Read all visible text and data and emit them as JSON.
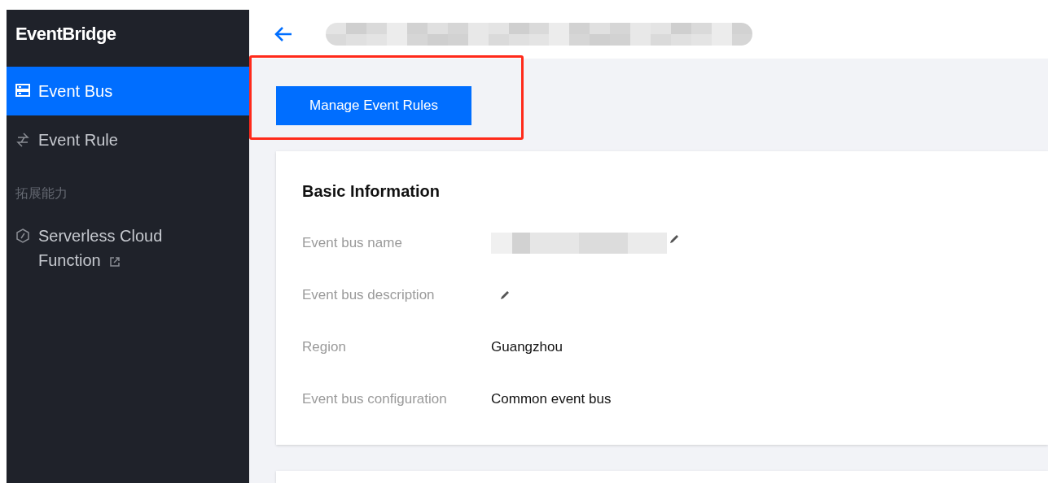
{
  "sidebar": {
    "title": "EventBridge",
    "items": [
      {
        "kind": "item",
        "label": "Event Bus",
        "selected": true,
        "external": false
      },
      {
        "kind": "item",
        "label": "Event Rule",
        "selected": false,
        "external": false
      },
      {
        "kind": "group",
        "label": "拓展能力"
      },
      {
        "kind": "item",
        "label": "Serverless Cloud Function",
        "selected": false,
        "external": true
      }
    ]
  },
  "toolbar": {
    "button": "Manage Event Rules"
  },
  "card": {
    "title": "Basic Information",
    "fields": [
      {
        "label": "Event bus name",
        "kind": "redacted",
        "editable": true
      },
      {
        "label": "Event bus description",
        "kind": "empty",
        "editable": true
      },
      {
        "label": "Region",
        "kind": "text",
        "value": "Guangzhou",
        "editable": false
      },
      {
        "label": "Event bus configuration",
        "kind": "text",
        "value": "Common event bus",
        "editable": false
      }
    ]
  }
}
